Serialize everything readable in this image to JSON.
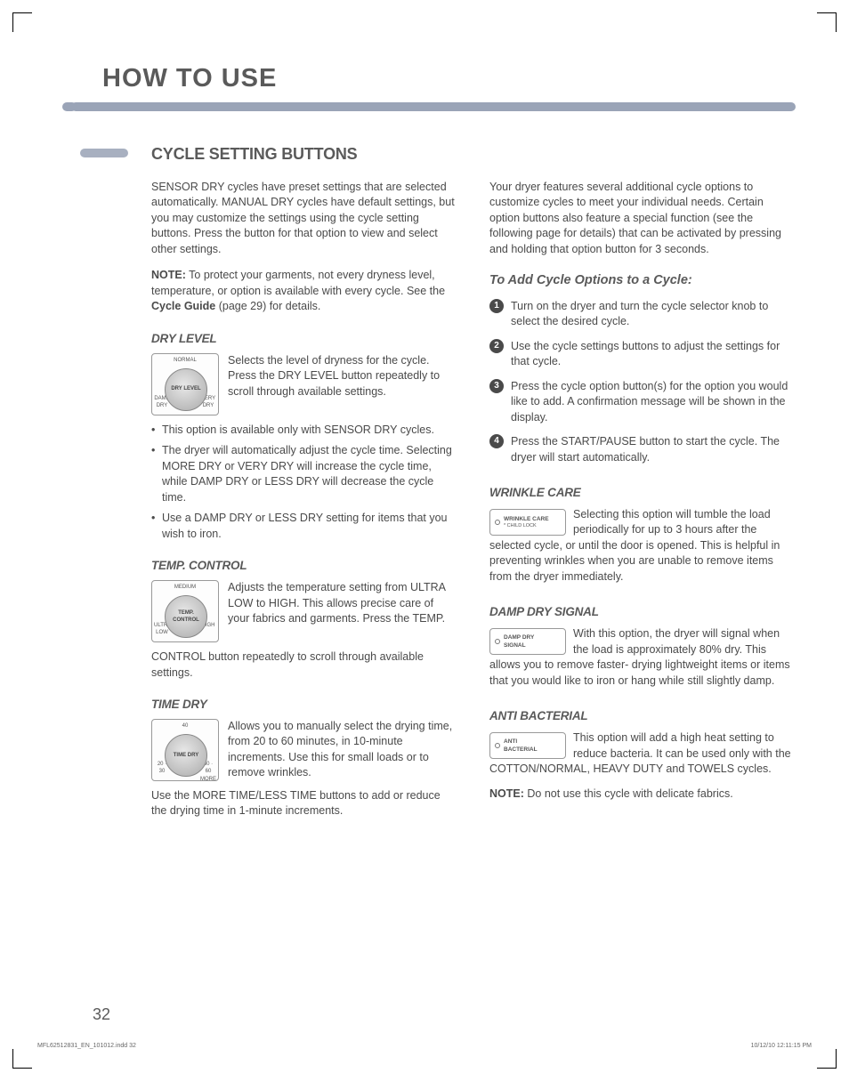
{
  "header": {
    "title": "HOW TO USE"
  },
  "section": {
    "title": "CYCLE SETTING BUTTONS"
  },
  "colL": {
    "intro": "SENSOR DRY cycles have preset settings that are selected automatically. MANUAL DRY cycles have default settings, but you may customize the settings using the cycle setting buttons. Press the button for that option to view and select other settings.",
    "note_label": "NOTE:",
    "note_text": " To protect your garments, not every dryness level, temperature, or option is available with every cycle. See the ",
    "note_bold": "Cycle Guide",
    "note_tail": " (page 29) for details.",
    "dry": {
      "heading": "DRY LEVEL",
      "knob": {
        "top": "NORMAL",
        "center": "DRY\nLEVEL",
        "left": "DAMP DRY",
        "right": "VERY DRY"
      },
      "desc": "Selects the level of dryness for the cycle. Press the DRY LEVEL button repeatedly to scroll through available settings.",
      "bullets": [
        "This option is available only with SENSOR DRY cycles.",
        "The dryer will automatically adjust the cycle time. Selecting MORE DRY or VERY DRY will increase the cycle time, while DAMP DRY or LESS DRY will decrease the cycle time.",
        "Use a DAMP DRY or LESS DRY setting for items that you wish to iron."
      ]
    },
    "temp": {
      "heading": "TEMP. CONTROL",
      "knob": {
        "top": "MEDIUM",
        "center": "TEMP.\nCONTROL",
        "left": "ULTRA LOW",
        "right": "HIGH"
      },
      "desc": "Adjusts the temperature setting from ULTRA LOW to HIGH. This allows precise care of your fabrics and garments. Press the TEMP.",
      "tail": "CONTROL button repeatedly to scroll through available settings."
    },
    "time": {
      "heading": "TIME DRY",
      "knob": {
        "top": "40",
        "center": "TIME\nDRY",
        "left": "20 · 30",
        "right": "50 · 60 MORE"
      },
      "desc": "Allows you to manually select the drying time, from 20 to 60 minutes, in 10-minute increments. Use this for small loads or to remove wrinkles.",
      "tail": "Use the MORE TIME/LESS TIME buttons to add or reduce the drying time in 1-minute increments."
    }
  },
  "colR": {
    "intro": "Your dryer features several additional cycle options to customize cycles to meet your individual needs. Certain option buttons also feature a special function (see the following page for details) that can be activated by pressing and holding that option button for 3 seconds.",
    "steps_title": "To Add Cycle Options to a Cycle:",
    "steps": [
      "Turn on the dryer and turn the cycle selector knob to select the desired cycle.",
      "Use the cycle settings buttons to adjust the settings for that cycle.",
      "Press the cycle option button(s) for the option you would like to add. A confirmation message will be shown in the display.",
      "Press the START/PAUSE button to start the cycle. The dryer will start automatically."
    ],
    "wrinkle": {
      "heading": "WRINKLE CARE",
      "btn_line1": "WRINKLE CARE",
      "btn_line2": "* CHILD LOCK",
      "text": "Selecting this option will tumble the load periodically for up to 3 hours after the selected cycle, or until the door is opened. This is helpful in preventing wrinkles when you are unable to remove items from the dryer immediately."
    },
    "damp": {
      "heading": "DAMP DRY SIGNAL",
      "btn_line1": "DAMP DRY",
      "btn_line2": "SIGNAL",
      "text": "With this option, the dryer will signal when the load is approximately 80%  dry. This allows you to remove faster- drying lightweight items or items that you would like to iron or hang while still slightly damp."
    },
    "anti": {
      "heading": "ANTI BACTERIAL",
      "btn_line1": "ANTI",
      "btn_line2": "BACTERIAL",
      "text": "This option will add a high heat setting to reduce bacteria. It can be used only with the COTTON/NORMAL, HEAVY DUTY and TOWELS cycles.",
      "note_label": "NOTE:",
      "note_text": " Do not use this cycle with delicate fabrics."
    }
  },
  "page_number": "32",
  "footer": {
    "left": "MFL62512831_EN_101012.indd   32",
    "right": "10/12/10   12:11:15 PM"
  }
}
